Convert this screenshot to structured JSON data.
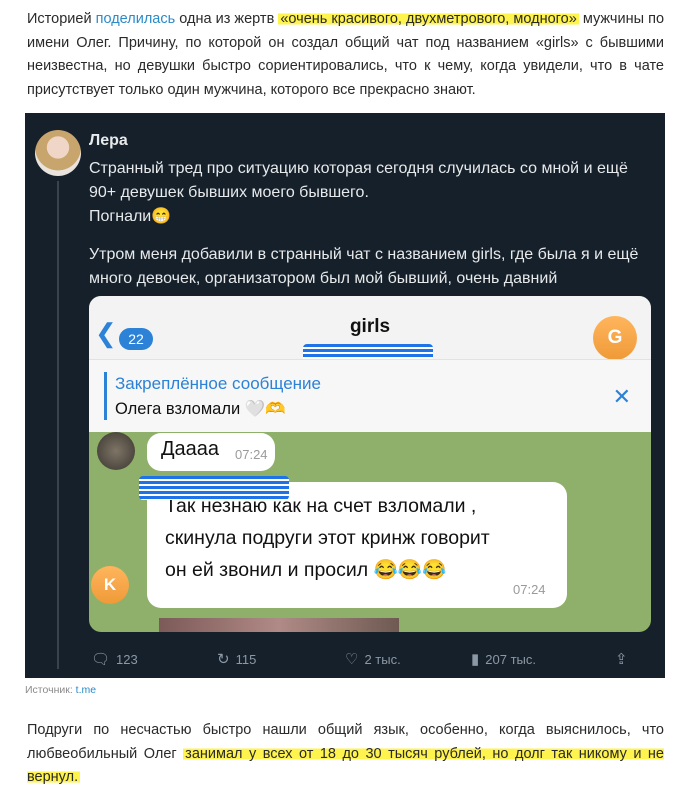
{
  "paragraph1": {
    "p1": "Историей ",
    "link": "поделилась",
    "p2": " одна из жертв ",
    "highlight": "«очень красивого, двухметрового, модного»",
    "p3": " мужчины по имени Олег. Причину, по которой он создал общий чат под названием «girls» с бывшими неизвестна, но девушки быстро сориентировались, что к чему, когда увидели, что в чате присутствует только один мужчина, которого все прекрасно знают."
  },
  "tweet": {
    "author": "Лера",
    "text1": "Странный тред про ситуацию которая сегодня случилась со мной и ещё 90+ девушек бывших моего бывшего.\nПогнали😁",
    "text2": "Утром меня добавили в странный чат с названием girls, где была я и ещё много девочек, организатором был мой бывший, очень давний",
    "telegram": {
      "back_count": "22",
      "chat_title": "girls",
      "avatar_letter": "G",
      "pinned_title": "Закреплённое сообщение",
      "pinned_text": "Олега взломали 🤍🫶",
      "messages": [
        {
          "text": "Даааа",
          "time": "07:24"
        },
        {
          "text": "Так незнаю как на счет взломали ,\nскинула подруги этот кринж говорит\nон ей звонил и просил 😂😂😂",
          "time": "07:24",
          "avatar_letter": "K"
        }
      ]
    },
    "actions": {
      "replies": "123",
      "retweets": "115",
      "likes": "2 тыс.",
      "views": "207 тыс."
    },
    "icons": [
      "reply-icon",
      "retweet-icon",
      "heart-icon",
      "views-icon",
      "share-icon"
    ]
  },
  "source": {
    "label": "Источник: ",
    "link": "t.me"
  },
  "paragraph2": {
    "p1": "Подруги по несчастью быстро нашли общий язык, особенно, когда выяснилось, что любвеобильный Олег ",
    "highlight": "занимал у всех от 18 до 30 тысяч рублей, но долг так никому и не вернул.",
    "p2": ""
  },
  "colors": {
    "highlight": "#fff34d",
    "link": "#2a8bc9",
    "tweet_bg": "#15202b",
    "telegram_accent": "#2b82d6",
    "chat_bg": "#8fb06a"
  }
}
